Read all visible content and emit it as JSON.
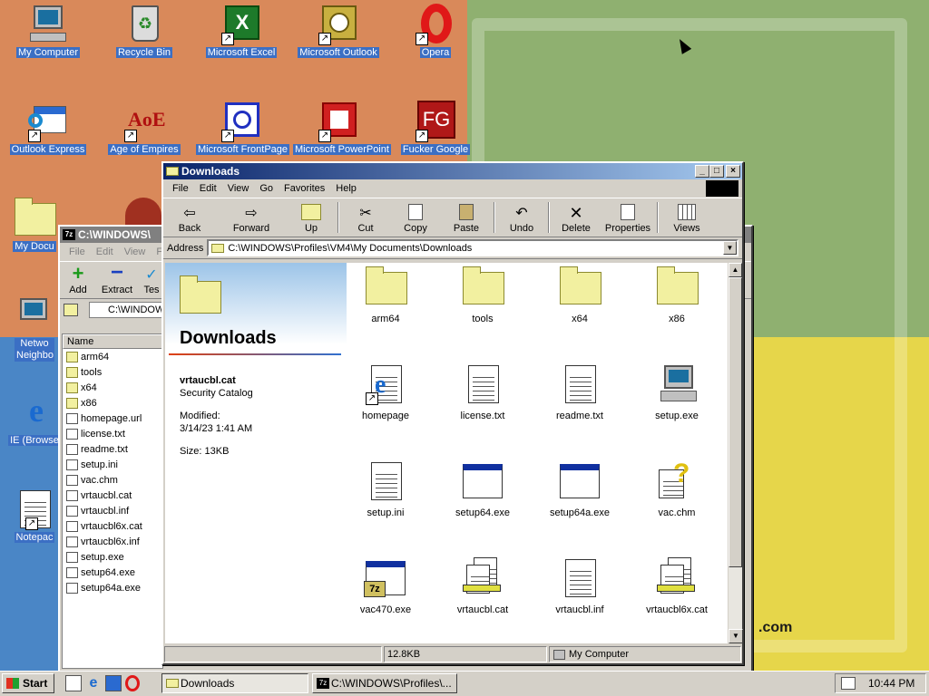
{
  "desktop": {
    "icons": [
      {
        "label": "My Computer",
        "icon": "computer-icon"
      },
      {
        "label": "Recycle Bin",
        "icon": "recycle-bin-icon"
      },
      {
        "label": "Microsoft Excel",
        "icon": "excel-icon"
      },
      {
        "label": "Microsoft Outlook",
        "icon": "outlook-icon"
      },
      {
        "label": "Opera",
        "icon": "opera-icon"
      },
      {
        "label": "Outlook Express",
        "icon": "outlook-express-icon"
      },
      {
        "label": "Age of Empires",
        "icon": "age-of-empires-icon"
      },
      {
        "label": "Microsoft FrontPage",
        "icon": "frontpage-icon"
      },
      {
        "label": "Microsoft PowerPoint",
        "icon": "powerpoint-icon"
      },
      {
        "label": "Fucker Google",
        "icon": "fg-icon"
      },
      {
        "label": "My Docu",
        "icon": "documents-icon"
      },
      {
        "label": "Netwo Neighbo",
        "icon": "network-icon"
      },
      {
        "label": "IE (Browse",
        "icon": "ie-icon"
      },
      {
        "label": "Notepac",
        "icon": "notepad-icon"
      }
    ],
    "wallpaper_text": ".com"
  },
  "explorer": {
    "title": "Downloads",
    "menu": [
      "File",
      "Edit",
      "View",
      "Go",
      "Favorites",
      "Help"
    ],
    "toolbar": [
      "Back",
      "Forward",
      "Up",
      "Cut",
      "Copy",
      "Paste",
      "Undo",
      "Delete",
      "Properties",
      "Views"
    ],
    "address_label": "Address",
    "address": "C:\\WINDOWS\\Profiles\\VM4\\My Documents\\Downloads",
    "panel": {
      "heading": "Downloads",
      "file_name": "vrtaucbl.cat",
      "file_type": "Security Catalog",
      "modified_label": "Modified:",
      "modified": "3/14/23 1:41 AM",
      "size": "Size: 13KB"
    },
    "files": [
      {
        "name": "arm64",
        "type": "folder"
      },
      {
        "name": "tools",
        "type": "folder"
      },
      {
        "name": "x64",
        "type": "folder"
      },
      {
        "name": "x86",
        "type": "folder"
      },
      {
        "name": "homepage",
        "type": "ie"
      },
      {
        "name": "license.txt",
        "type": "doc"
      },
      {
        "name": "readme.txt",
        "type": "doc"
      },
      {
        "name": "setup.exe",
        "type": "setup"
      },
      {
        "name": "setup.ini",
        "type": "ini"
      },
      {
        "name": "setup64.exe",
        "type": "exe"
      },
      {
        "name": "setup64a.exe",
        "type": "exe"
      },
      {
        "name": "vac.chm",
        "type": "chm"
      },
      {
        "name": "vac470.exe",
        "type": "7z"
      },
      {
        "name": "vrtaucbl.cat",
        "type": "cat"
      },
      {
        "name": "vrtaucbl.inf",
        "type": "ini"
      },
      {
        "name": "vrtaucbl6x.cat",
        "type": "cat"
      }
    ],
    "status_size": "12.8KB",
    "status_zone": "My Computer"
  },
  "zipwin": {
    "title": "C:\\WINDOWS\\",
    "menu": [
      "File",
      "Edit",
      "View",
      "Fa"
    ],
    "toolbar": [
      "Add",
      "Extract",
      "Tes"
    ],
    "path": "C:\\WINDOW",
    "col_name": "Name",
    "items": [
      "arm64",
      "tools",
      "x64",
      "x86",
      "homepage.url",
      "license.txt",
      "readme.txt",
      "setup.ini",
      "vac.chm",
      "vrtaucbl.cat",
      "vrtaucbl.inf",
      "vrtaucbl6x.cat",
      "vrtaucbl6x.inf",
      "setup.exe",
      "setup64.exe",
      "setup64a.exe"
    ]
  },
  "taskbar": {
    "start": "Start",
    "tasks": [
      "Downloads",
      "C:\\WINDOWS\\Profiles\\..."
    ],
    "time": "10:44 PM"
  }
}
